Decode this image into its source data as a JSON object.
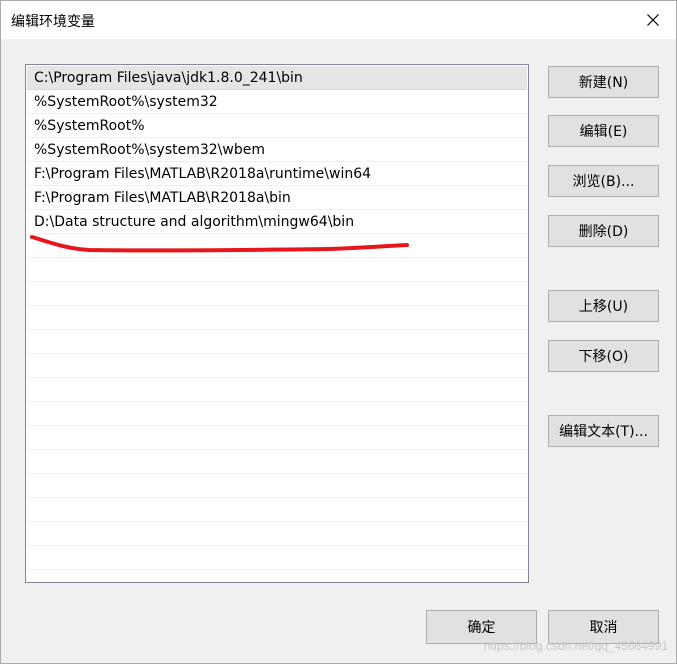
{
  "window": {
    "title": "编辑环境变量"
  },
  "paths": [
    "C:\\Program Files\\java\\jdk1.8.0_241\\bin",
    "%SystemRoot%\\system32",
    "%SystemRoot%",
    "%SystemRoot%\\system32\\wbem",
    "F:\\Program Files\\MATLAB\\R2018a\\runtime\\win64",
    "F:\\Program Files\\MATLAB\\R2018a\\bin",
    "D:\\Data structure and algorithm\\mingw64\\bin"
  ],
  "selected_index": 0,
  "buttons": {
    "new": "新建(N)",
    "edit": "编辑(E)",
    "browse": "浏览(B)...",
    "delete": "删除(D)",
    "move_up": "上移(U)",
    "move_down": "下移(O)",
    "edit_text": "编辑文本(T)...",
    "ok": "确定",
    "cancel": "取消"
  },
  "watermark": "https://blog.csdn.net/qq_45664991",
  "colors": {
    "annotation": "#e8151b",
    "selected_row": "#e5e5e5",
    "button_face": "#e1e1e1"
  }
}
